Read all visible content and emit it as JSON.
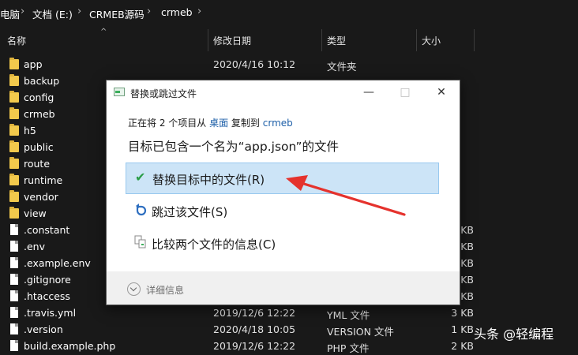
{
  "breadcrumb": {
    "items": [
      "电脑",
      "文档 (E:)",
      "CRMEB源码",
      "crmeb"
    ],
    "separator": "›"
  },
  "columns": {
    "name": "名称",
    "date": "修改日期",
    "type": "类型",
    "size": "大小"
  },
  "files": [
    {
      "name": "app",
      "date": "2020/4/16 10:12",
      "type": "文件夹",
      "size": "",
      "kind": "folder"
    },
    {
      "name": "backup",
      "date": "",
      "type": "",
      "size": "",
      "kind": "folder"
    },
    {
      "name": "config",
      "date": "",
      "type": "",
      "size": "",
      "kind": "folder"
    },
    {
      "name": "crmeb",
      "date": "",
      "type": "",
      "size": "",
      "kind": "folder"
    },
    {
      "name": "h5",
      "date": "",
      "type": "",
      "size": "",
      "kind": "folder"
    },
    {
      "name": "public",
      "date": "",
      "type": "",
      "size": "",
      "kind": "folder"
    },
    {
      "name": "route",
      "date": "",
      "type": "",
      "size": "",
      "kind": "folder"
    },
    {
      "name": "runtime",
      "date": "",
      "type": "",
      "size": "",
      "kind": "folder"
    },
    {
      "name": "vendor",
      "date": "",
      "type": "",
      "size": "",
      "kind": "folder"
    },
    {
      "name": "view",
      "date": "",
      "type": "",
      "size": "",
      "kind": "folder"
    },
    {
      "name": ".constant",
      "date": "",
      "type": "",
      "size": "KB",
      "kind": "file"
    },
    {
      "name": ".env",
      "date": "",
      "type": "",
      "size": "KB",
      "kind": "file"
    },
    {
      "name": ".example.env",
      "date": "",
      "type": "",
      "size": "KB",
      "kind": "file"
    },
    {
      "name": ".gitignore",
      "date": "",
      "type": "",
      "size": "KB",
      "kind": "file"
    },
    {
      "name": ".htaccess",
      "date": "",
      "type": "",
      "size": "KB",
      "kind": "file"
    },
    {
      "name": ".travis.yml",
      "date": "2019/12/6 12:22",
      "type": "YML 文件",
      "size": "3 KB",
      "kind": "file"
    },
    {
      "name": ".version",
      "date": "2020/4/18 10:05",
      "type": "VERSION 文件",
      "size": "1 KB",
      "kind": "file"
    },
    {
      "name": "build.example.php",
      "date": "2019/12/6 12:22",
      "type": "PHP 文件",
      "size": "2 KB",
      "kind": "file"
    }
  ],
  "dialog": {
    "title": "替换或跳过文件",
    "subtitle": {
      "prefix": "正在将 2 个项目从 ",
      "source": "桌面",
      "middle": " 复制到 ",
      "destination": "crmeb"
    },
    "heading": "目标已包含一个名为“app.json”的文件",
    "options": [
      {
        "label": "替换目标中的文件(R)",
        "icon": "checkmark-icon",
        "selected": true
      },
      {
        "label": "跳过该文件(S)",
        "icon": "skip-icon",
        "selected": false
      },
      {
        "label": "比较两个文件的信息(C)",
        "icon": "compare-icon",
        "selected": false
      }
    ],
    "details_label": "详细信息"
  },
  "watermark": "头条 @轻编程",
  "colors": {
    "background": "#191919",
    "selected_option": "#cce4f7",
    "link": "#1d5fa8",
    "arrow": "#e5322d",
    "folder": "#f2c94c"
  }
}
